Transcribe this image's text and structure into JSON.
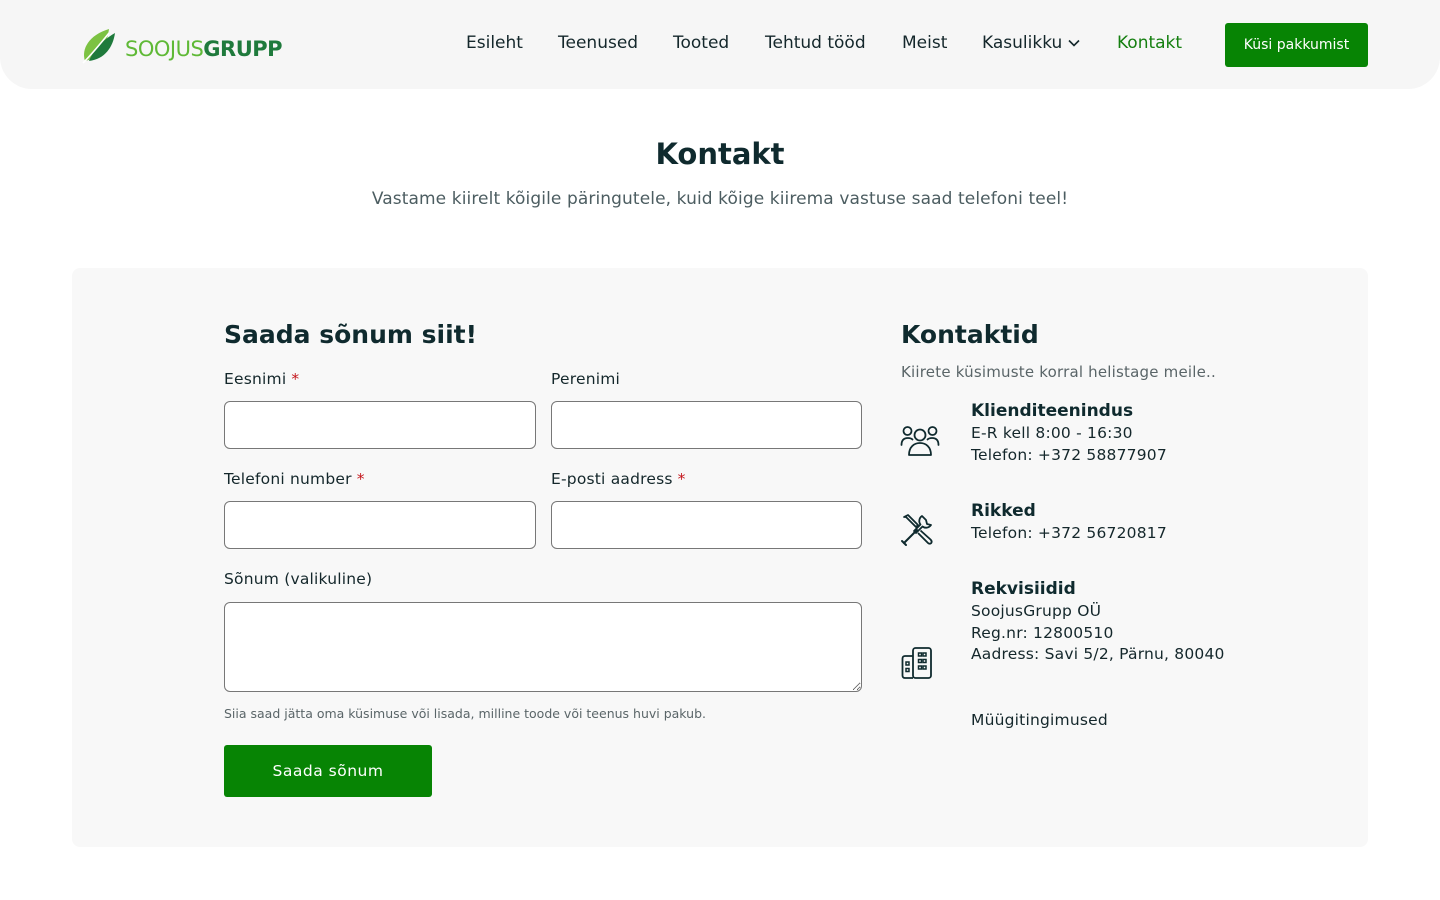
{
  "brand": {
    "logo_part1": "SOOJUS",
    "logo_part2": "GRUPP",
    "colors": {
      "accent": "#078404",
      "logo_light": "#5fb936",
      "logo_dark": "#1f7a3c",
      "required": "#c4161c"
    }
  },
  "nav": {
    "items": [
      {
        "label": "Esileht"
      },
      {
        "label": "Teenused"
      },
      {
        "label": "Tooted"
      },
      {
        "label": "Tehtud tööd"
      },
      {
        "label": "Meist"
      },
      {
        "label": "Kasulikku",
        "icon": "chevron-down-icon"
      },
      {
        "label": "Kontakt",
        "active": true
      }
    ],
    "cta_label": "Küsi pakkumist"
  },
  "hero": {
    "title": "Kontakt",
    "subtitle": "Vastame kiirelt kõigile päringutele, kuid kõige kiirema vastuse saad telefoni teel!"
  },
  "form": {
    "title": "Saada sõnum siit!",
    "required_marker": "*",
    "fields": {
      "first_name": {
        "label": "Eesnimi",
        "value": "",
        "required": true
      },
      "last_name": {
        "label": "Perenimi",
        "value": "",
        "required": false
      },
      "phone": {
        "label": "Telefoni number",
        "value": "",
        "required": true
      },
      "email": {
        "label": "E-posti aadress",
        "value": "",
        "required": true
      },
      "message": {
        "label": "Sõnum (valikuline)",
        "value": "",
        "required": false
      }
    },
    "helper": "Siia saad jätta oma küsimuse või lisada, milline toode või teenus huvi pakub.",
    "submit_label": "Saada sõnum"
  },
  "contacts": {
    "title": "Kontaktid",
    "subtitle": "Kiirete küsimuste korral helistage meile..",
    "blocks": [
      {
        "icon": "users-icon",
        "heading": "Klienditeenindus",
        "lines": [
          "E-R kell 8:00 - 16:30",
          "Telefon: +372 58877907"
        ]
      },
      {
        "icon": "tools-icon",
        "heading": "Rikked",
        "lines": [
          "Telefon: +372 56720817"
        ]
      },
      {
        "icon": "buildings-icon",
        "heading": "Rekvisiidid",
        "lines": [
          "SoojusGrupp OÜ",
          "Reg.nr: 12800510",
          "Aadress: Savi 5/2, Pärnu, 80040"
        ]
      }
    ],
    "terms_link": "Müügitingimused"
  }
}
